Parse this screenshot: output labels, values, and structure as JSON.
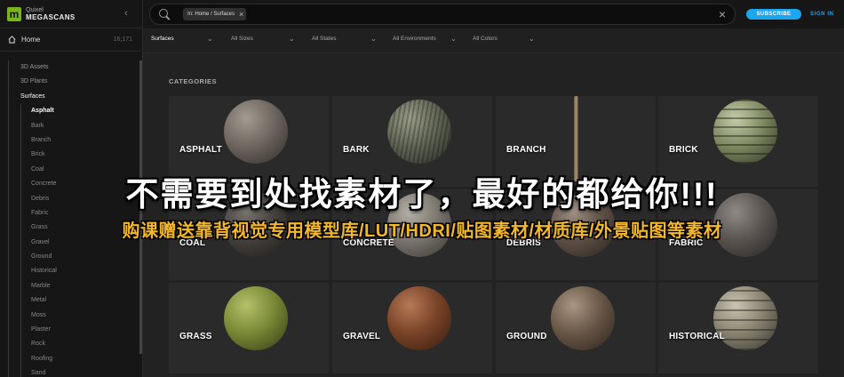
{
  "brand": {
    "small": "Quixel",
    "big": "MEGASCANS",
    "logo": "m"
  },
  "nav": {
    "collapse_icon": "‹",
    "home_label": "Home",
    "home_count": "16,171",
    "tree": [
      "3D Assets",
      "3D Plants",
      "Surfaces"
    ],
    "surfaces": [
      "Asphalt",
      "Bark",
      "Branch",
      "Brick",
      "Coal",
      "Concrete",
      "Debris",
      "Fabric",
      "Grass",
      "Gravel",
      "Ground",
      "Historical",
      "Marble",
      "Metal",
      "Moss",
      "Plaster",
      "Rock",
      "Roofing",
      "Sand"
    ],
    "active_tree": "Surfaces",
    "active_surface": "Asphalt"
  },
  "search": {
    "chip": "In: Home / Surfaces",
    "chip_close": "×",
    "clear": "×"
  },
  "header": {
    "subscribe": "SUBSCRIBE",
    "signin": "SIGN IN",
    "accent": "#1ba6f0"
  },
  "filters": [
    "Surfaces",
    "All Sizes",
    "All States",
    "All Environments",
    "All Colors"
  ],
  "main": {
    "section_title": "CATEGORIES"
  },
  "categories": [
    "ASPHALT",
    "BARK",
    "BRANCH",
    "BRICK",
    "COAL",
    "CONCRETE",
    "DEBRIS",
    "FABRIC",
    "GRASS",
    "GRAVEL",
    "GROUND",
    "HISTORICAL"
  ],
  "promo": {
    "line1": "不需要到处找素材了，最好的都给你!!!",
    "line2": "购课赠送靠背视觉专用模型库/LUT/HDRI/贴图素材/材质库/外景贴图等素材",
    "line2_color": "#f3b72a"
  }
}
